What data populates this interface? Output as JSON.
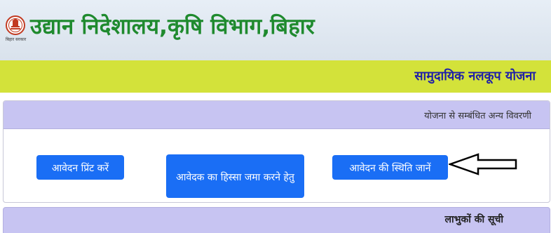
{
  "header": {
    "title": "उद्यान निदेशालय,कृषि विभाग,बिहार",
    "logo_caption": "बिहार सरकार",
    "logo_icon": "bihar-emblem-icon",
    "title_color": "#1f8a2e"
  },
  "scheme": {
    "title": "सामुदायिक नलकूप योजना",
    "bar_color": "#d3e23a",
    "title_color": "#1f1fa8"
  },
  "details_panel": {
    "heading": "योजना से सम्बंधित अन्य विवरणी",
    "buttons": {
      "print_label": "आवेदन प्रिंट करें",
      "share_label": "आवेदक का हिस्सा जमा करने हेतु",
      "status_label": "आवेदन की स्थिति जानें"
    },
    "pointer_icon": "left-arrow-icon",
    "button_color": "#1a6ef5"
  },
  "beneficiary_panel": {
    "heading": "लाभुकों की सूची"
  }
}
